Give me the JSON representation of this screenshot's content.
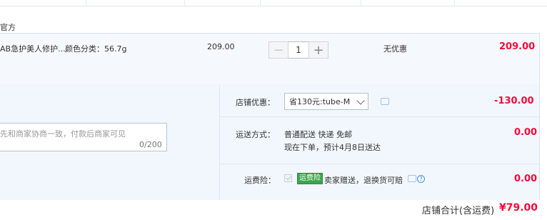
{
  "store": {
    "name": "官方"
  },
  "item": {
    "name": "AB急护美人修护...",
    "spec": "颜色分类：56.7g",
    "unit_price": "209.00",
    "quantity": "1",
    "minus_label": "−",
    "plus_label": "+",
    "discount": "无优惠",
    "subtotal": "209.00"
  },
  "shop_coupon": {
    "label": "店铺优惠：",
    "selected": "省130元:tube-M",
    "amount": "-130.00"
  },
  "memo": {
    "placeholder": "先和商家协商一致，付款后商家可见",
    "counter": "0/200"
  },
  "shipping": {
    "label": "运送方式：",
    "method": "普通配送 快递 免邮",
    "eta": "现在下单，预计4月8日送达",
    "amount": "0.00"
  },
  "insurance": {
    "label": "运费险：",
    "badge": "运费险",
    "text": "卖家赠送，退换货可赔",
    "amount": "0.00",
    "help_glyph": "?"
  },
  "total": {
    "label": "店铺合计(含运费)",
    "amount": "¥79.00"
  },
  "colors": {
    "price_red": "#f40b3a",
    "row_bg": "#f5f8fd",
    "badge_green": "#3ca44c"
  }
}
